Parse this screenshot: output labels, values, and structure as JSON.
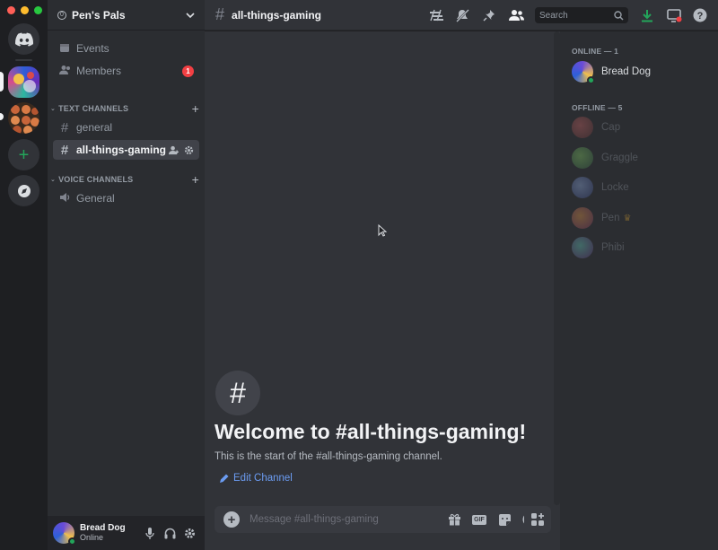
{
  "window": {
    "traffic_lights": [
      "#ff5f57",
      "#febc2e",
      "#28c840"
    ]
  },
  "server_rail": {
    "items": [
      {
        "name": "home",
        "icon": "discord-logo-icon"
      },
      {
        "name": "server-1",
        "icon": "server-avatar"
      },
      {
        "name": "pens-pals",
        "icon": "server-avatar"
      },
      {
        "name": "add-server",
        "icon": "plus-icon"
      },
      {
        "name": "explore",
        "icon": "compass-icon"
      }
    ]
  },
  "guild": {
    "name": "Pen's Pals",
    "boost_count": "0"
  },
  "sidebar": {
    "events_label": "Events",
    "members_label": "Members",
    "members_badge": "1",
    "text_category": "TEXT CHANNELS",
    "text_channels": [
      {
        "name": "general"
      },
      {
        "name": "all-things-gaming"
      }
    ],
    "voice_category": "VOICE CHANNELS",
    "voice_channels": [
      {
        "name": "General"
      }
    ]
  },
  "user_panel": {
    "name": "Bread Dog",
    "status": "Online"
  },
  "topbar": {
    "channel_name": "all-things-gaming",
    "search_placeholder": "Search"
  },
  "chat": {
    "welcome_title": "Welcome to #all-things-gaming!",
    "welcome_sub": "This is the start of the #all-things-gaming channel.",
    "edit_channel": "Edit Channel",
    "composer_placeholder": "Message #all-things-gaming",
    "gif_label": "GIF"
  },
  "member_list": {
    "online_header": "ONLINE — 1",
    "online": [
      {
        "name": "Bread Dog"
      }
    ],
    "offline_header": "OFFLINE — 5",
    "offline": [
      {
        "name": "Cap"
      },
      {
        "name": "Graggle"
      },
      {
        "name": "Locke"
      },
      {
        "name": "Pen"
      },
      {
        "name": "Phibi"
      }
    ]
  },
  "colors": {
    "accent": "#5865f2",
    "online": "#23a55a",
    "badge": "#f23f43",
    "link": "#6b9cf2",
    "download": "#23a55a"
  }
}
